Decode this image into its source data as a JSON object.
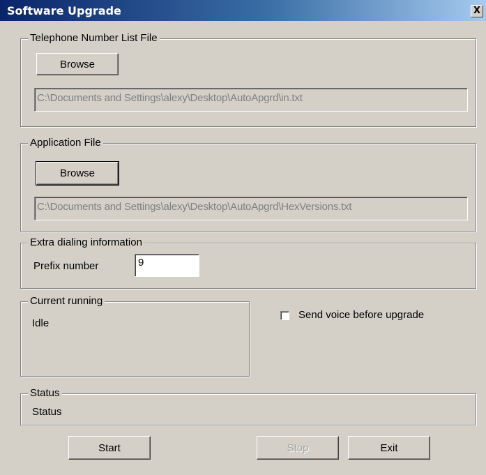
{
  "window": {
    "title": "Software Upgrade",
    "close_label": "X"
  },
  "phone_list": {
    "legend": "Telephone Number List File",
    "browse_label": "Browse",
    "path": "C:\\Documents and Settings\\alexy\\Desktop\\AutoApgrd\\in.txt"
  },
  "application_file": {
    "legend": "Application File",
    "browse_label": "Browse",
    "path": "C:\\Documents and Settings\\alexy\\Desktop\\AutoApgrd\\HexVersions.txt"
  },
  "extra_dialing": {
    "legend": "Extra dialing information",
    "prefix_label": "Prefix number",
    "prefix_value": "9"
  },
  "current_running": {
    "legend": "Current running",
    "value": "Idle"
  },
  "send_voice": {
    "label": "Send voice before upgrade",
    "checked": false
  },
  "status": {
    "legend": "Status",
    "value": "Status"
  },
  "buttons": {
    "start": "Start",
    "stop": "Stop",
    "exit": "Exit"
  }
}
